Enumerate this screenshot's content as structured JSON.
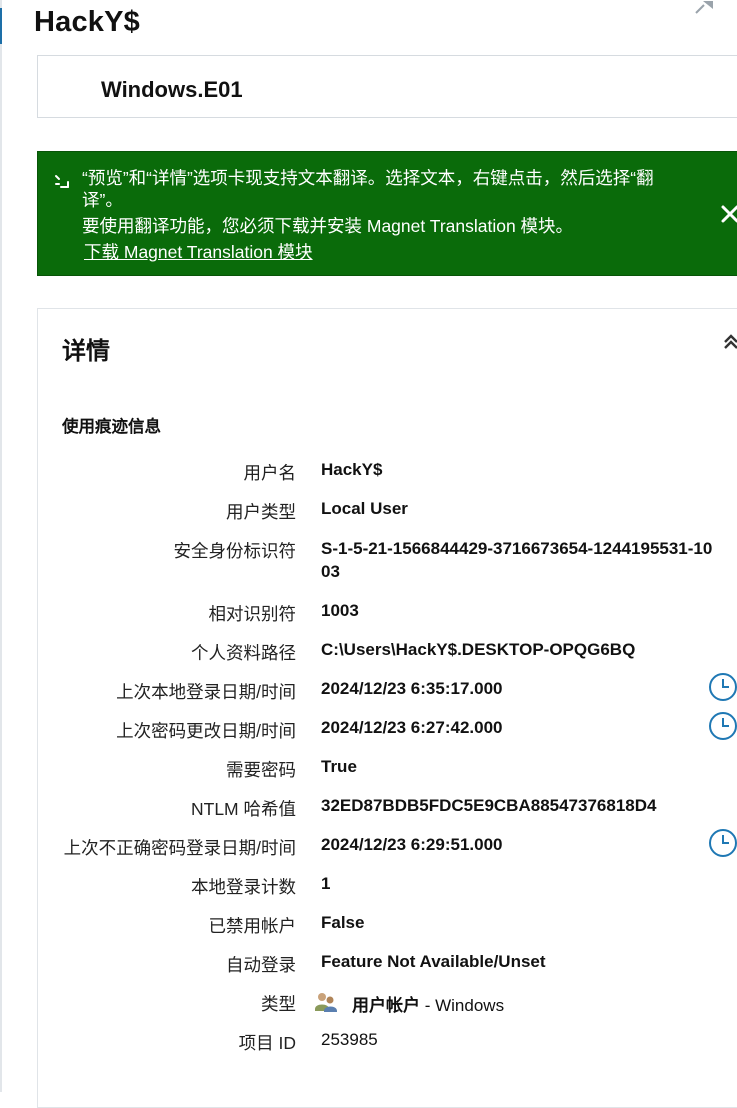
{
  "header": {
    "title": "HackY$"
  },
  "evidence": {
    "name": "Windows.E01"
  },
  "banner": {
    "line1": "“预览”和“详情”选项卡现支持文本翻译。选择文本，右键点击，然后选择“翻译”。",
    "line2": "要使用翻译功能，您必须下载并安装 Magnet Translation 模块。",
    "link": "下载 Magnet Translation 模块",
    "background": "#0a6b0a"
  },
  "details": {
    "title": "详情",
    "section": "使用痕迹信息",
    "rows": [
      {
        "label": "用户名",
        "value": "HackY$"
      },
      {
        "label": "用户类型",
        "value": "Local User"
      },
      {
        "label": "安全身份标识符",
        "value": "S-1-5-21-1566844429-3716673654-1244195531-1003"
      },
      {
        "label": "相对识别符",
        "value": "1003"
      },
      {
        "label": "个人资料路径",
        "value": "C:\\Users\\HackY$.DESKTOP-OPQG6BQ"
      },
      {
        "label": "上次本地登录日期/时间",
        "value": "2024/12/23 6:35:17.000"
      },
      {
        "label": "上次密码更改日期/时间",
        "value": "2024/12/23 6:27:42.000"
      },
      {
        "label": "需要密码",
        "value": "True"
      },
      {
        "label": "NTLM 哈希值",
        "value": "32ED87BDB5FDC5E9CBA88547376818D4"
      },
      {
        "label": "上次不正确密码登录日期/时间",
        "value": "2024/12/23 6:29:51.000"
      },
      {
        "label": "本地登录计数",
        "value": "1"
      },
      {
        "label": "已禁用帐户",
        "value": "False"
      },
      {
        "label": "自动登录",
        "value": "Feature Not Available/Unset"
      },
      {
        "label": "类型",
        "value": "用户帐户",
        "suffix": " - Windows"
      },
      {
        "label": "项目 ID",
        "value": "253985"
      }
    ]
  },
  "icons": {
    "clock": "clock-icon",
    "user-account": "user-account-icon",
    "close": "close-icon",
    "collapse": "chevron-up-double-icon"
  },
  "colors": {
    "accent": "#1d6fa8",
    "clock": "#1f78b4"
  }
}
